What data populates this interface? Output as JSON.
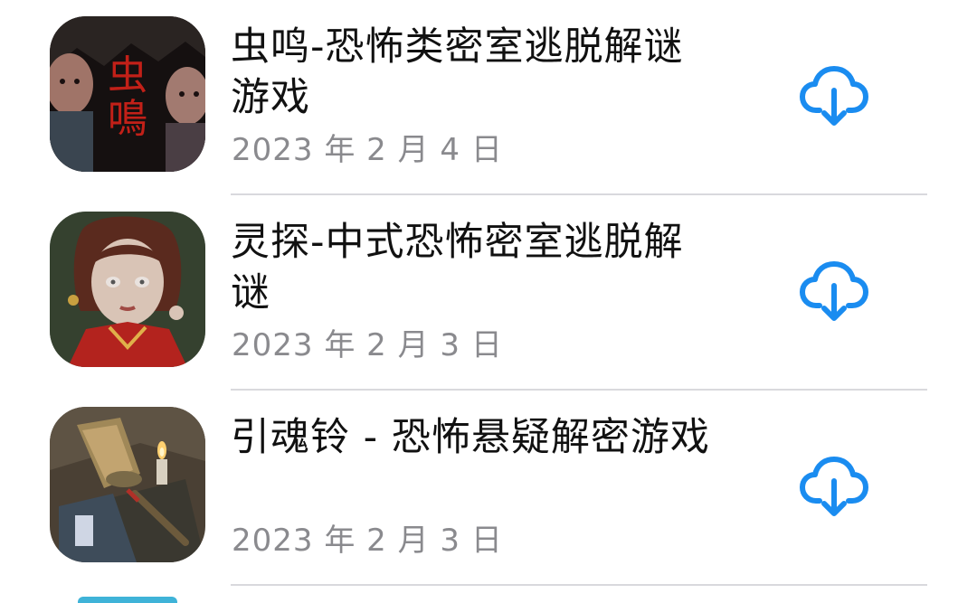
{
  "apps": [
    {
      "title": "虫鸣-恐怖类密室逃脱解谜游戏",
      "date": "2023 年 2 月 4 日",
      "icon_text": "虫鳴",
      "download_icon": "cloud-download-icon"
    },
    {
      "title": "灵探-中式恐怖密室逃脱解谜",
      "date": "2023 年 2 月 3 日",
      "download_icon": "cloud-download-icon"
    },
    {
      "title": "引魂铃 - 恐怖悬疑解密游戏",
      "date": "2023 年 2 月 3 日",
      "download_icon": "cloud-download-icon"
    }
  ],
  "colors": {
    "accent": "#1a8cf0",
    "secondary_text": "#8a8a8e",
    "separator": "#d9d9dd"
  }
}
